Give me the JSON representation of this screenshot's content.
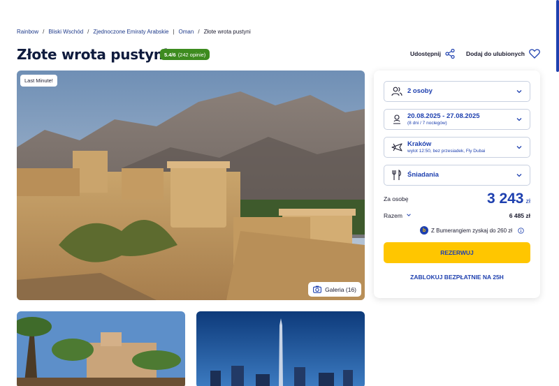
{
  "breadcrumb": {
    "items": [
      "Rainbow",
      "Bliski Wschód",
      "Zjednoczone Emiraty Arabskie",
      "Oman",
      "Złote wrota pustyni"
    ],
    "separators": [
      "/",
      "/",
      "|",
      "/"
    ]
  },
  "header": {
    "title": "Złote wrota pustyni",
    "rating_score": "5.4/6",
    "rating_count": "(242 opinie)",
    "share_label": "Udostępnij",
    "favorite_label": "Dodaj do ulubionych"
  },
  "hero": {
    "badge": "Last Minute!",
    "gallery_label": "Galeria (16)"
  },
  "booking": {
    "persons": "2 osoby",
    "dates": "20.08.2025 - 27.08.2025",
    "dates_sub": "(8 dni / 7 noclegów)",
    "departure": "Kraków",
    "departure_sub": "wylot 12:50, bez przesiadek, Fly Dubai",
    "board": "Śniadania",
    "per_person_label": "Za osobę",
    "per_person_price": "3 243",
    "currency": "zł",
    "total_label": "Razem",
    "total_value": "6 485 zł",
    "bumerang_text": "Z Bumerangiem zyskaj do 260 zł",
    "bumerang_icon": "b",
    "reserve_label": "REZERWUJ",
    "lock_label": "ZABLOKUJ BEZPŁATNIE NA 25H"
  },
  "colors": {
    "brand_blue": "#1e40af",
    "accent_yellow": "#ffc600",
    "rating_green": "#3d8b1f"
  }
}
